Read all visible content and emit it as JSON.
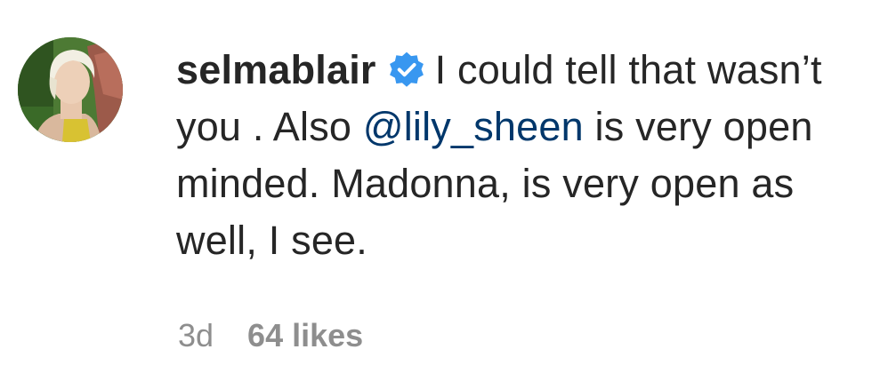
{
  "comment": {
    "username": "selmablair",
    "verified_icon": "verified-badge-icon",
    "verified_color": "#3897f0",
    "text_before_mention": "I could tell that wasn’t you . Also ",
    "mention": "@lily_sheen",
    "mention_color": "#00376b",
    "text_after_mention": " is very open minded. Madonna, is very open as well, I see.",
    "timestamp": "3d",
    "likes": "64 likes"
  }
}
